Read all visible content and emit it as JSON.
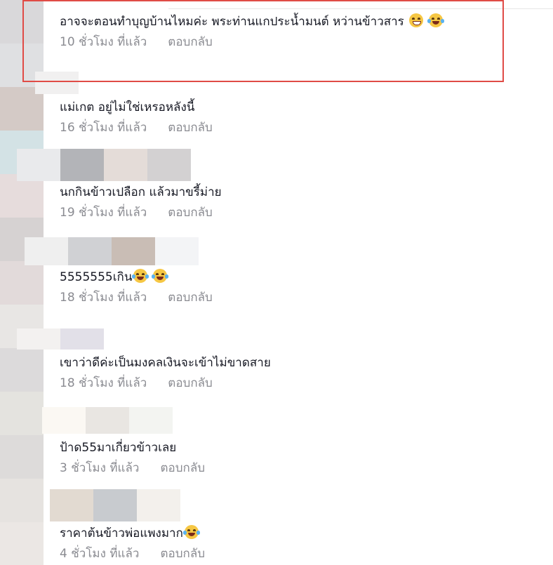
{
  "comments": [
    {
      "text": "อาจจะตอนทำบุญบ้านไหมค่ะ พระท่านแกประน้ำมนต์ หว่านข้าวสาร",
      "emoji": [
        "grin-emoji",
        "joy-emoji"
      ],
      "time": "10 ชั่วโมง ที่แล้ว",
      "reply": "ตอบกลับ"
    },
    {
      "text": "แม่เกต อยู่ไม่ใช่เหรอหลังนี้",
      "emoji": [],
      "time": "16 ชั่วโมง ที่แล้ว",
      "reply": "ตอบกลับ"
    },
    {
      "text": "นกกินข้าวเปลือก แล้วมาขรี้ม่าย",
      "emoji": [],
      "time": "19 ชั่วโมง ที่แล้ว",
      "reply": "ตอบกลับ"
    },
    {
      "text": "5555555เกิน",
      "emoji": [
        "joy-emoji",
        "joy-emoji"
      ],
      "time": "18 ชั่วโมง ที่แล้ว",
      "reply": "ตอบกลับ"
    },
    {
      "text": "เขาว่าดีค่ะเป็นมงคลเงินจะเข้าไม่ขาดสาย",
      "emoji": [],
      "time": "18 ชั่วโมง ที่แล้ว",
      "reply": "ตอบกลับ"
    },
    {
      "text": "ป้าด55มาเกี่ยวข้าวเลย",
      "emoji": [],
      "time": "3 ชั่วโมง ที่แล้ว",
      "reply": "ตอบกลับ"
    },
    {
      "text": "ราคาต้นข้าวพ่อแพงมาก",
      "emoji": [
        "joy-emoji"
      ],
      "time": "4 ชั่วโมง ที่แล้ว",
      "reply": "ตอบกลับ"
    }
  ],
  "colors": {
    "highlight": "#e04b46",
    "text": "#161823",
    "meta": "#8a8b91"
  }
}
